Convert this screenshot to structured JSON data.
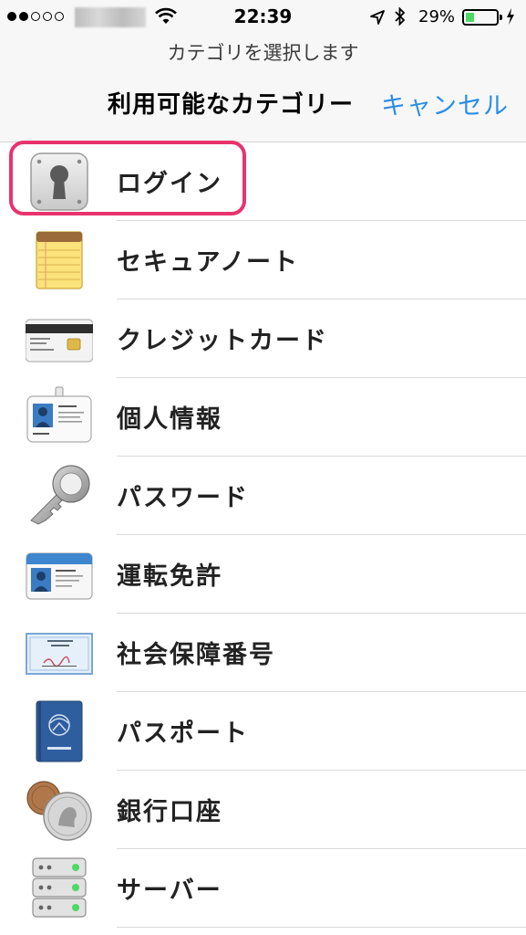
{
  "status_bar": {
    "time": "22:39",
    "battery_percent": "29%",
    "signal_bars_filled": 2,
    "signal_bars_total": 5,
    "battery_level": 0.29,
    "battery_color": "#4cd964"
  },
  "header": {
    "prompt": "カテゴリを選択します",
    "title": "利用可能なカテゴリー",
    "cancel_label": "キャンセル",
    "accent_color": "#2b8ee6"
  },
  "categories": [
    {
      "label": "ログイン",
      "icon": "login-keyhole-icon",
      "highlighted": true
    },
    {
      "label": "セキュアノート",
      "icon": "secure-note-notepad-icon"
    },
    {
      "label": "クレジットカード",
      "icon": "credit-card-icon"
    },
    {
      "label": "個人情報",
      "icon": "identity-badge-icon"
    },
    {
      "label": "パスワード",
      "icon": "password-key-icon"
    },
    {
      "label": "運転免許",
      "icon": "drivers-license-icon"
    },
    {
      "label": "社会保障番号",
      "icon": "social-security-card-icon"
    },
    {
      "label": "パスポート",
      "icon": "passport-icon"
    },
    {
      "label": "銀行口座",
      "icon": "bank-account-coins-icon"
    },
    {
      "label": "サーバー",
      "icon": "server-rack-icon"
    }
  ],
  "highlight_color": "#e8336e"
}
